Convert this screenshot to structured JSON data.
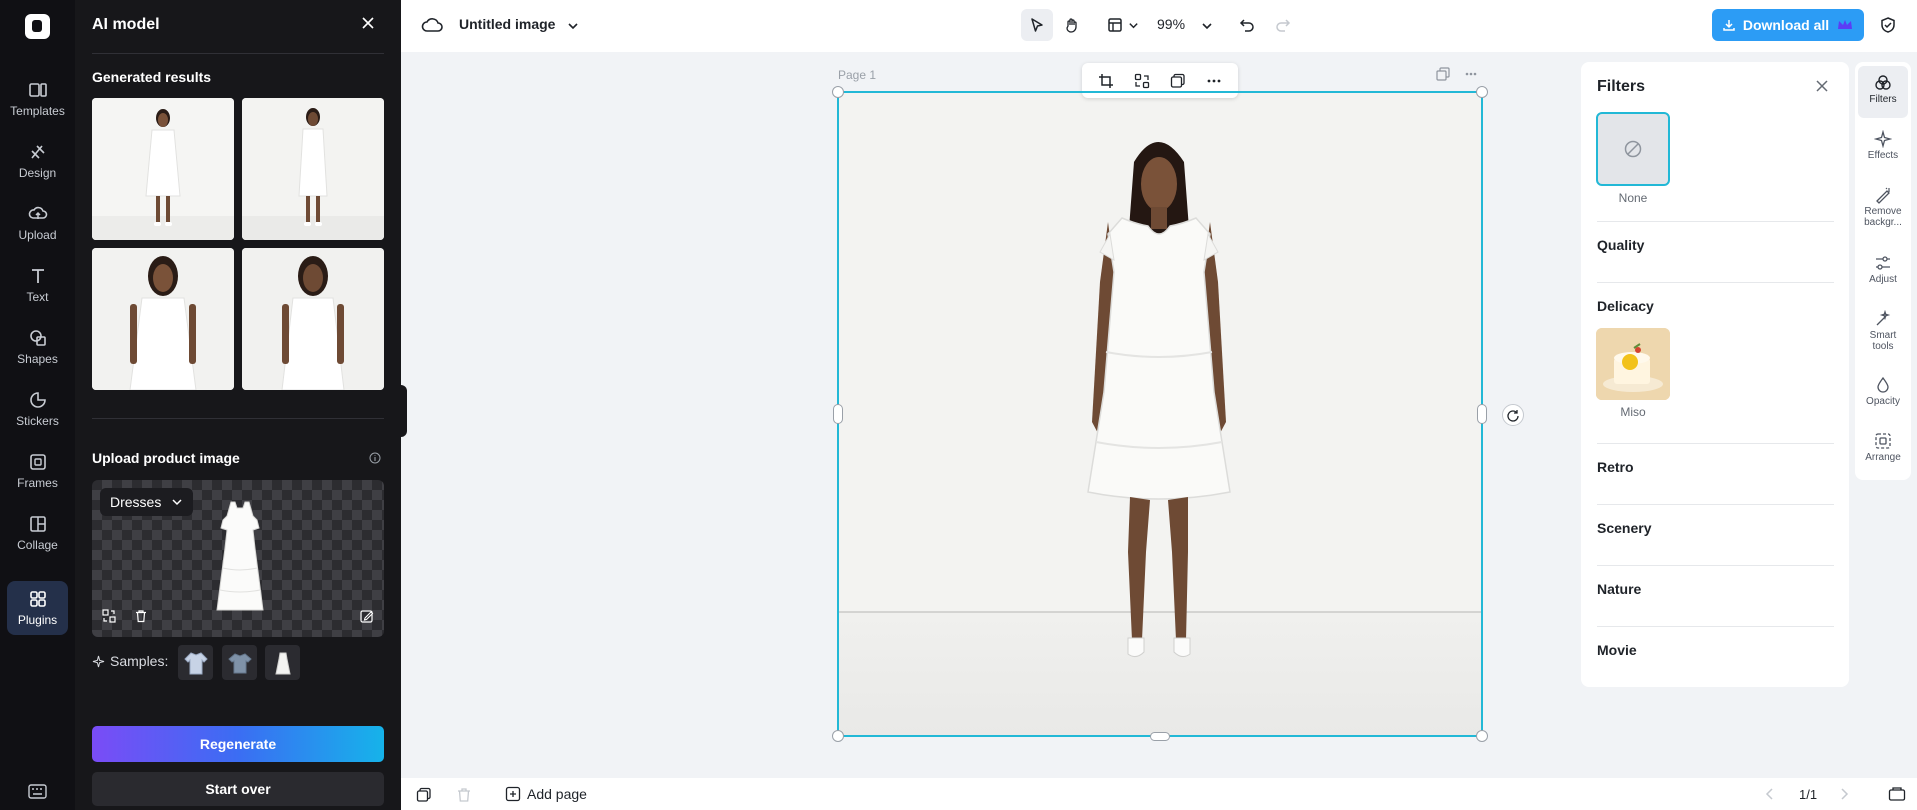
{
  "left_rail": {
    "items": [
      {
        "label": "Templates",
        "icon": "templates-icon"
      },
      {
        "label": "Design",
        "icon": "design-icon"
      },
      {
        "label": "Upload",
        "icon": "upload-icon"
      },
      {
        "label": "Text",
        "icon": "text-icon"
      },
      {
        "label": "Shapes",
        "icon": "shapes-icon"
      },
      {
        "label": "Stickers",
        "icon": "stickers-icon"
      },
      {
        "label": "Frames",
        "icon": "frames-icon"
      },
      {
        "label": "Collage",
        "icon": "collage-icon"
      },
      {
        "label": "Plugins",
        "icon": "plugins-icon",
        "active": true
      }
    ]
  },
  "ai_panel": {
    "title": "AI model",
    "generated_title": "Generated results",
    "upload_title": "Upload product image",
    "category": "Dresses",
    "samples_label": "Samples:",
    "regenerate": "Regenerate",
    "start_over": "Start over"
  },
  "topbar": {
    "doc_title": "Untitled image",
    "zoom": "99%",
    "download": "Download all"
  },
  "canvas": {
    "page_label": "Page 1"
  },
  "filters": {
    "title": "Filters",
    "none_label": "None",
    "sections": [
      "Quality",
      "Delicacy",
      "Retro",
      "Scenery",
      "Nature",
      "Movie"
    ],
    "miso_label": "Miso"
  },
  "right_rail": {
    "items": [
      {
        "label": "Filters",
        "icon": "filters-icon",
        "active": true
      },
      {
        "label": "Effects",
        "icon": "effects-icon"
      },
      {
        "label": "Remove backgr...",
        "icon": "remove-background-icon"
      },
      {
        "label": "Adjust",
        "icon": "adjust-icon"
      },
      {
        "label": "Smart tools",
        "icon": "smart-tools-icon"
      },
      {
        "label": "Opacity",
        "icon": "opacity-icon"
      },
      {
        "label": "Arrange",
        "icon": "arrange-icon"
      }
    ]
  },
  "bottombar": {
    "add_page": "Add page",
    "pager": "1/1"
  },
  "colors": {
    "accent": "#22b8d6",
    "download": "#2c9cf5",
    "dark_panel": "#17171a"
  }
}
